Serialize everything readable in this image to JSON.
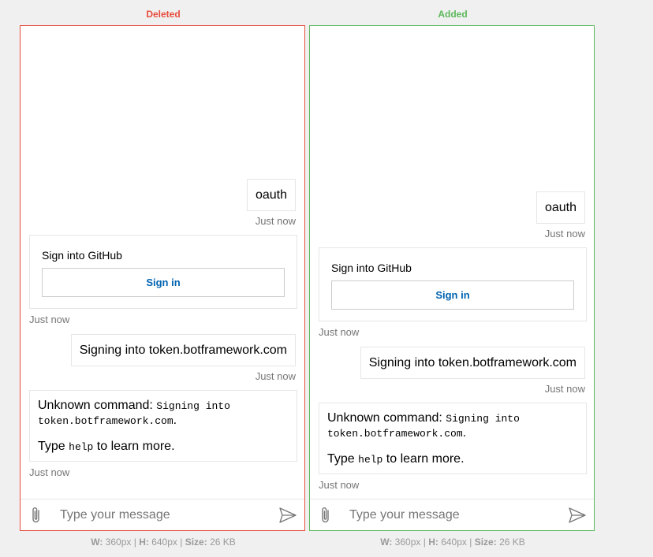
{
  "panels": [
    {
      "label": "Deleted",
      "color": "#e74c3c",
      "chat": {
        "user_message": "oauth",
        "user_message_ts": "Just now",
        "card_title": "Sign into GitHub",
        "card_button": "Sign in",
        "card_ts": "Just now",
        "user_message2": "Signing into token.botframework.com",
        "user_message2_ts": "Just now",
        "bot_prefix": "Unknown command: ",
        "bot_code": "Signing into token.botframework.com",
        "bot_suffix": ".",
        "bot_type": "Type ",
        "bot_help": "help",
        "bot_learn": " to learn more.",
        "bot_ts": "Just now",
        "placeholder": "Type your message"
      },
      "size": {
        "w_label": "W:",
        "w": "360",
        "h_label": "H:",
        "h": "640",
        "size_label": "Size:",
        "size": "26 KB"
      }
    },
    {
      "label": "Added",
      "color": "#5cb85c",
      "chat": {
        "user_message": "oauth",
        "user_message_ts": "Just now",
        "card_title": "Sign into GitHub",
        "card_button": "Sign in",
        "card_ts": "Just now",
        "user_message2": "Signing into token.botframework.com",
        "user_message2_ts": "Just now",
        "bot_prefix": "Unknown command: ",
        "bot_code": "Signing into token.botframework.com",
        "bot_suffix": ".",
        "bot_type": "Type ",
        "bot_help": "help",
        "bot_learn": " to learn more.",
        "bot_ts": "Just now",
        "placeholder": "Type your message"
      },
      "size": {
        "w_label": "W:",
        "w": "360",
        "h_label": "H:",
        "h": "640",
        "size_label": "Size:",
        "size": "26 KB"
      }
    }
  ],
  "units": {
    "px": "px",
    "sep": " | "
  }
}
